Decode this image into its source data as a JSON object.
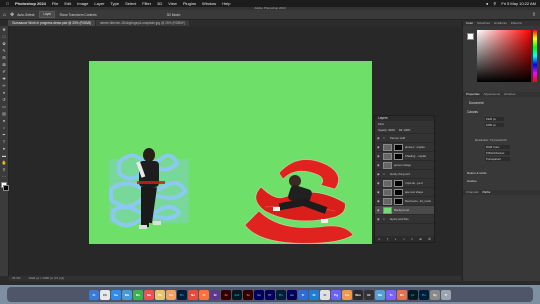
{
  "menubar": {
    "items": [
      "Photoshop 2024",
      "File",
      "Edit",
      "Image",
      "Layer",
      "Type",
      "Select",
      "Filter",
      "3D",
      "View",
      "Plugins",
      "Window",
      "Help"
    ],
    "clock": "Fri 5 May  10:22 AM"
  },
  "app_title": "Adobe Photoshop 2024",
  "options": {
    "auto_select": "Auto-Select:",
    "layer": "Layer",
    "transform": "Show Transform Controls",
    "mode_3d": "3D Mode:"
  },
  "tabs": [
    {
      "label": "Gumsauce Work in progress demo.psd @ 33% (RGB/8)",
      "active": true
    },
    {
      "label": "aimee-fletcher-JDs6g0ogsyA-unsplash.jpg @ 25% (RGB/8*)",
      "active": false
    }
  ],
  "status": {
    "zoom": "33.3%",
    "size": "1920 px x 1080 px (72 ppi)"
  },
  "right_panel": {
    "color_tabs": [
      "Color",
      "Swatches",
      "Gradients",
      "Patterns"
    ],
    "props_tabs": [
      "Properties",
      "Adjustments",
      "Libraries"
    ],
    "props_title": "Document",
    "canvas_label": "Canvas",
    "w_value": "1920 px",
    "h_value": "1080 px",
    "resolution": "Resolution: 72 pixels/inch",
    "mode": "RGB Color",
    "bits": "8 Bits/Channel",
    "fill": "Transparent",
    "rulers": "Rulers & Grids",
    "guides": "Guides",
    "bottom_tabs": [
      "Channels",
      "Paths"
    ]
  },
  "layers": {
    "title": "Layers",
    "kind": "Kind",
    "opacity_label": "Opacity: 100%",
    "fill_label": "Fill: 100%",
    "rows": [
      {
        "name": "Person stuff",
        "group": true
      },
      {
        "name": "aimee-f...nsplas",
        "mask": true
      },
      {
        "name": "Shading ...nsplas",
        "mask": true
      },
      {
        "name": "person shape",
        "mask": false
      },
      {
        "name": "bendy thing stuff",
        "group": true
      },
      {
        "name": "rrrpd-do...ps-3",
        "mask": true
      },
      {
        "name": "ape text shape",
        "mask": true
      },
      {
        "name": "Reel textu...kit_mock",
        "mask": true
      },
      {
        "name": "Background",
        "mask": false,
        "selected": true
      },
      {
        "name": "layers and files",
        "group": true
      }
    ]
  },
  "dock": {
    "apps": [
      "Fi",
      "Ch",
      "Sa",
      "Ma",
      "Ms",
      "Mu",
      "Ph",
      "Ca",
      "Ps",
      "Nu",
      "Ff",
      "Sl",
      "Ai",
      "Lrc",
      "Ai",
      "Ae",
      "Pr",
      "Ps",
      "Ae",
      "Tr",
      "St",
      "Fi",
      "Pg",
      "Fm",
      "Wm",
      "Dr",
      "Ma",
      "Ts",
      "Ds",
      "Lr",
      "Ps",
      "Sy",
      "Tr"
    ]
  },
  "colors": {
    "canvas_green": "#6ee06a",
    "ribbon_red": "#e0231e",
    "scribble_blue": "#8cc9f0",
    "accent": "#2d6bd8"
  }
}
